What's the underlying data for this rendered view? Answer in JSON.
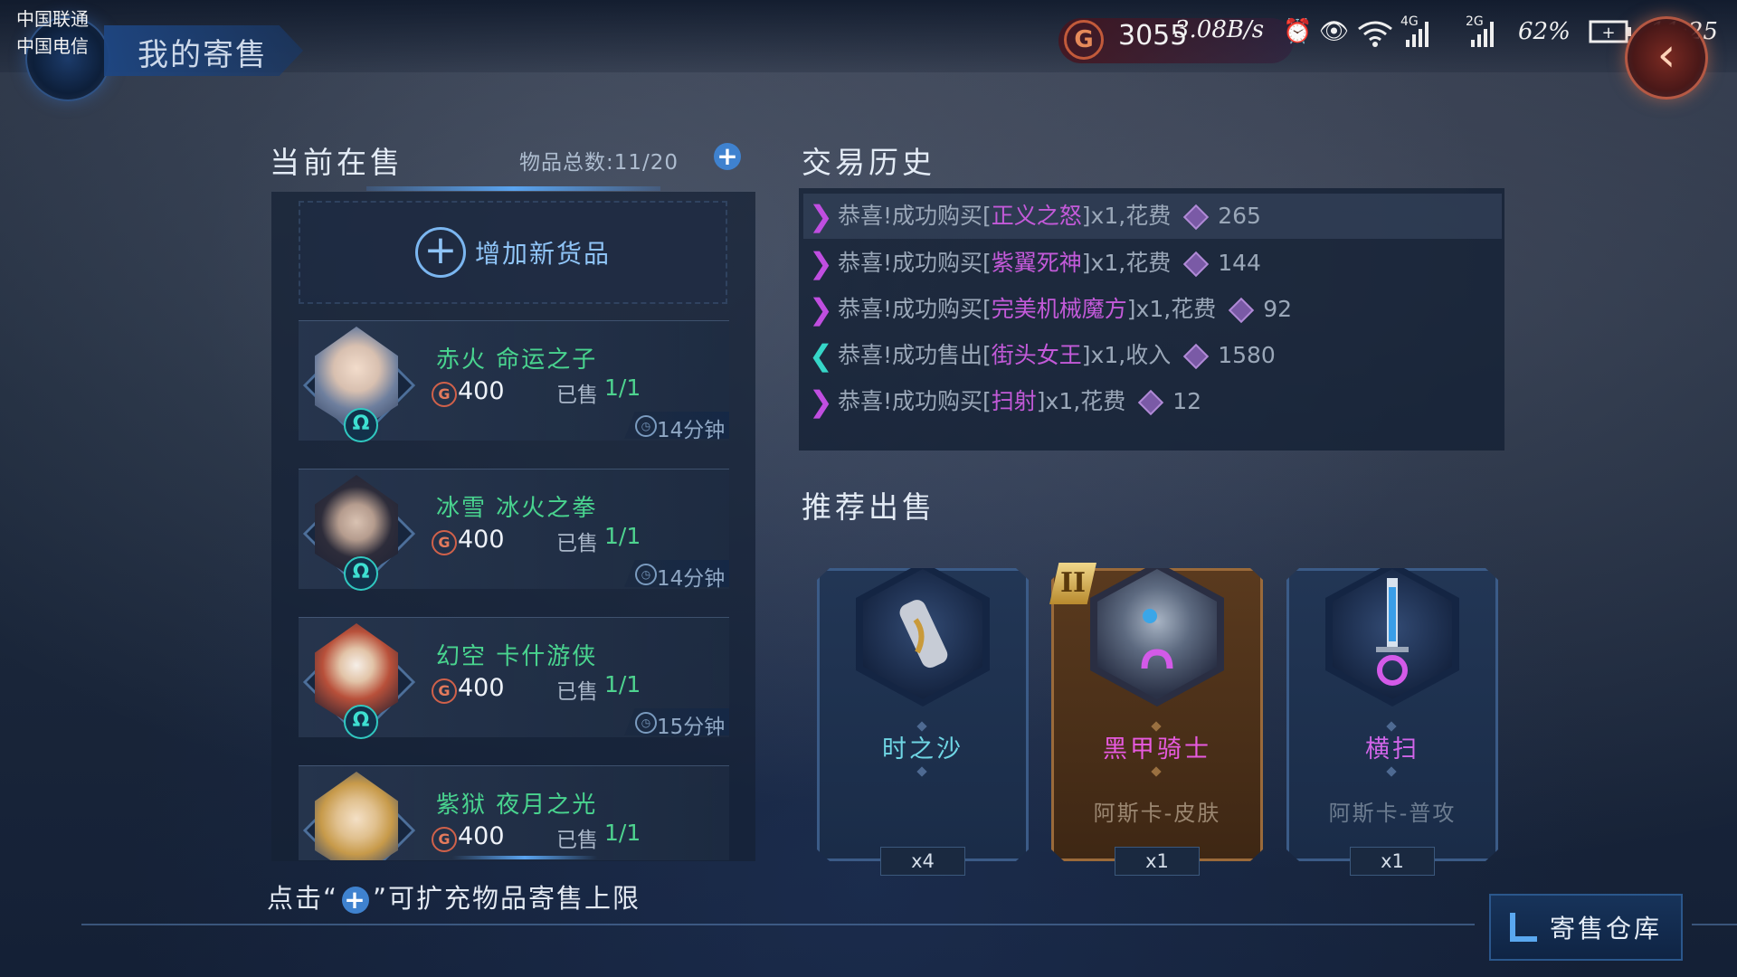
{
  "status_bar": {
    "carrier_1": "中国联通",
    "carrier_2": "中国电信",
    "gold_value": "3055",
    "status_text": "3.08B/s",
    "network_1": "4G",
    "network_2": "2G",
    "battery": "62%",
    "time": "11:25"
  },
  "header": {
    "title": "我的寄售"
  },
  "left": {
    "section_title": "当前在售",
    "total_label": "物品总数:11/20",
    "add_item_label": "增加新货品",
    "listings": [
      {
        "name": "赤火 命运之子",
        "price": "400",
        "sold_label": "已售",
        "sold_value": "1/1",
        "time": "14分钟"
      },
      {
        "name": "冰雪 冰火之拳",
        "price": "400",
        "sold_label": "已售",
        "sold_value": "1/1",
        "time": "14分钟"
      },
      {
        "name": "幻空 卡什游侠",
        "price": "400",
        "sold_label": "已售",
        "sold_value": "1/1",
        "time": "15分钟"
      },
      {
        "name": "紫狱 夜月之光",
        "price": "400",
        "sold_label": "已售",
        "sold_value": "1/1",
        "time": ""
      }
    ]
  },
  "history": {
    "section_title": "交易历史",
    "rows": [
      {
        "direction": "buy",
        "prefix": "恭喜!成功购买[",
        "item": "正义之怒",
        "suffix": "]x1,花费",
        "amount": "265"
      },
      {
        "direction": "buy",
        "prefix": "恭喜!成功购买[",
        "item": "紫翼死神",
        "suffix": "]x1,花费",
        "amount": "144"
      },
      {
        "direction": "buy",
        "prefix": "恭喜!成功购买[",
        "item": "完美机械魔方",
        "suffix": "]x1,花费",
        "amount": "92"
      },
      {
        "direction": "sell",
        "prefix": "恭喜!成功售出[",
        "item": "街头女王",
        "suffix": "]x1,收入",
        "amount": "1580"
      },
      {
        "direction": "buy",
        "prefix": "恭喜!成功购买[",
        "item": "扫射",
        "suffix": "]x1,花费",
        "amount": "12"
      }
    ],
    "colors": {
      "buy": "#c04ee0",
      "sell": "#36d6c8",
      "item": "#c35ad9"
    }
  },
  "recommended": {
    "section_title": "推荐出售",
    "rank_badge": "II",
    "cards": [
      {
        "name": "时之沙",
        "subtitle": "",
        "count": "x4",
        "icon": "hourglass-sand-icon"
      },
      {
        "name": "黑甲骑士",
        "subtitle": "阿斯卡-皮肤",
        "count": "x1",
        "icon": "armored-knight-portrait"
      },
      {
        "name": "横扫",
        "subtitle": "阿斯卡-普攻",
        "count": "x1",
        "icon": "sword-icon"
      }
    ]
  },
  "footer": {
    "hint_prefix": "点击“",
    "hint_suffix": "”可扩充物品寄售上限",
    "warehouse_label": "寄售仓库"
  }
}
